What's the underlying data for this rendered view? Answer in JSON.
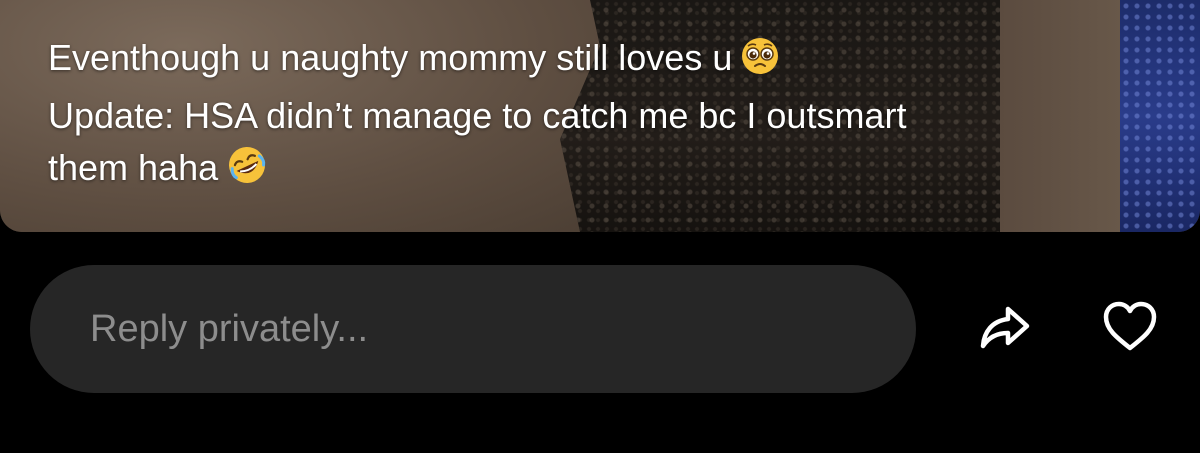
{
  "story": {
    "caption_lines": [
      "Eventhough u naughty mommy still loves u",
      "Update: HSA didn’t manage to catch me bc I outsmart",
      "them haha"
    ],
    "emoji_line1": "pleading-face",
    "emoji_line3": "rolling-on-floor-laughing"
  },
  "reply_bar": {
    "placeholder": "Reply privately...",
    "share_icon": "share-arrow-icon",
    "like_icon": "heart-icon"
  },
  "colors": {
    "background": "#000000",
    "input_bg": "#262626",
    "placeholder": "#8d8d8d",
    "icon": "#ffffff",
    "caption": "#ffffff"
  }
}
